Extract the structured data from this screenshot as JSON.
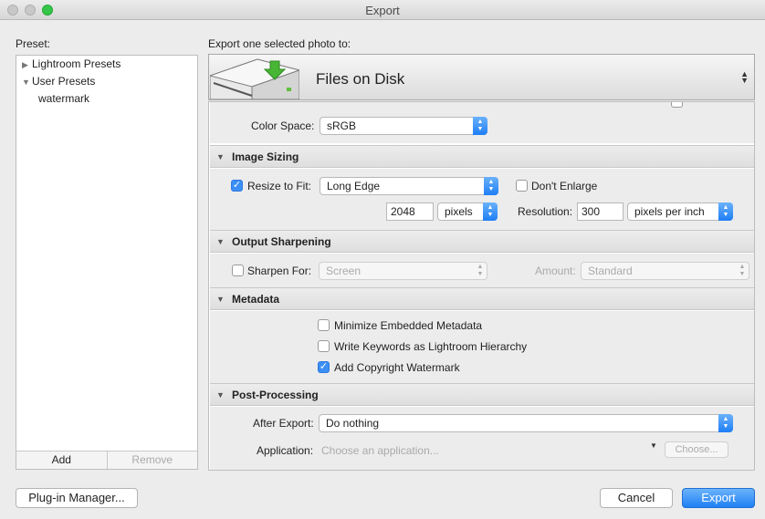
{
  "window": {
    "title": "Export"
  },
  "preset": {
    "label": "Preset:",
    "items": [
      {
        "label": "Lightroom Presets",
        "expanded": false
      },
      {
        "label": "User Presets",
        "expanded": true
      },
      {
        "label": "watermark"
      }
    ],
    "add_label": "Add",
    "remove_label": "Remove"
  },
  "destination": {
    "header": "Export one selected photo to:",
    "value": "Files on Disk"
  },
  "color_space": {
    "label": "Color Space:",
    "value": "sRGB"
  },
  "image_sizing": {
    "title": "Image Sizing",
    "resize_label": "Resize to Fit:",
    "resize_checked": true,
    "resize_mode": "Long Edge",
    "dont_enlarge_label": "Don't Enlarge",
    "dont_enlarge_checked": false,
    "size_value": "2048",
    "size_unit": "pixels",
    "resolution_label": "Resolution:",
    "resolution_value": "300",
    "resolution_unit": "pixels per inch"
  },
  "output_sharpening": {
    "title": "Output Sharpening",
    "sharpen_label": "Sharpen For:",
    "sharpen_checked": false,
    "sharpen_value": "Screen",
    "amount_label": "Amount:",
    "amount_value": "Standard"
  },
  "metadata": {
    "title": "Metadata",
    "options": [
      {
        "label": "Minimize Embedded Metadata",
        "checked": false
      },
      {
        "label": "Write Keywords as Lightroom Hierarchy",
        "checked": false
      },
      {
        "label": "Add Copyright Watermark",
        "checked": true
      }
    ]
  },
  "post_processing": {
    "title": "Post-Processing",
    "after_export_label": "After Export:",
    "after_export_value": "Do nothing",
    "application_label": "Application:",
    "application_placeholder": "Choose an application...",
    "choose_label": "Choose..."
  },
  "buttons": {
    "plugin_manager": "Plug-in Manager...",
    "cancel": "Cancel",
    "export": "Export"
  },
  "colors": {
    "accent": "#2f86f6",
    "zoom": "#35c649"
  }
}
